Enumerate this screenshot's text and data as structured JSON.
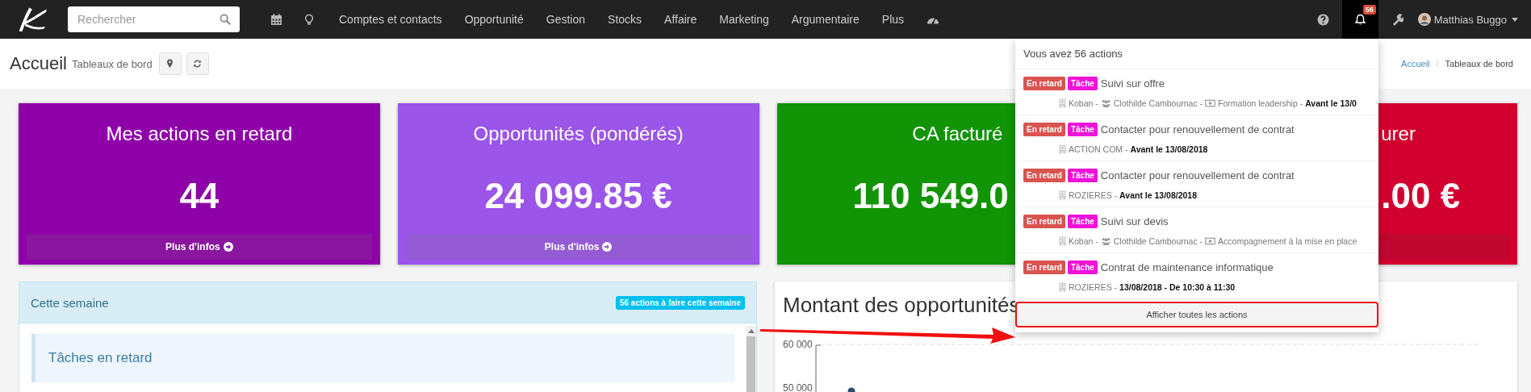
{
  "navbar": {
    "search": {
      "placeholder": "Rechercher"
    },
    "menu": [
      "Comptes et contacts",
      "Opportunité",
      "Gestion",
      "Stocks",
      "Affaire",
      "Marketing",
      "Argumentaire",
      "Plus"
    ],
    "notifications": {
      "count": "56",
      "selected": true
    },
    "user": {
      "name": "Matthias Buggo"
    }
  },
  "header": {
    "title": "Accueil",
    "subtitle": "Tableaux de bord",
    "breadcrumb": {
      "separator": "/",
      "items": [
        {
          "label": "Accueil",
          "link": true
        },
        {
          "label": "Tableaux de bord",
          "link": false
        }
      ]
    }
  },
  "cards": [
    {
      "kind": "full",
      "color": "#8e00a8",
      "title": "Mes actions en retard",
      "value": "44",
      "footer": "Plus d'infos"
    },
    {
      "kind": "full",
      "color": "#9b55e8",
      "title": "Opportunités (pondérés)",
      "value": "24 099.85 €",
      "footer": "Plus d'infos"
    },
    {
      "kind": "left-of-menu",
      "color": "#119405",
      "title": "CA facturé",
      "value": "110 549.0"
    },
    {
      "kind": "right-of-menu",
      "color": "#d2002f",
      "title": "urer",
      "value": ".00 €"
    }
  ],
  "week_panel": {
    "title": "Cette semaine",
    "badge": "56 actions à faire cette semaine",
    "section": "Tâches en retard"
  },
  "chart_panel": {
    "title": "Montant des opportunités",
    "y_axis_labels": [
      "60 000",
      "50 000"
    ]
  },
  "actions_menu": {
    "header": "Vous avez 56 actions",
    "items": [
      {
        "status": "En retard",
        "type": "Tâche",
        "title": "Suivi sur offre",
        "meta": [
          {
            "kind": "company",
            "text": "Koban -"
          },
          {
            "kind": "contact",
            "text": "Clothilde Cambournac -"
          },
          {
            "kind": "project",
            "text": "Formation leadership -"
          },
          {
            "kind": "date",
            "text": "Avant le 13/0"
          }
        ]
      },
      {
        "status": "En retard",
        "type": "Tâche",
        "title": "Contacter pour renouvellement de contrat",
        "meta": [
          {
            "kind": "company",
            "text": "ACTION COM -"
          },
          {
            "kind": "date",
            "text": "Avant le 13/08/2018"
          }
        ]
      },
      {
        "status": "En retard",
        "type": "Tâche",
        "title": "Contacter pour renouvellement de contrat",
        "meta": [
          {
            "kind": "company",
            "text": "ROZIERES -"
          },
          {
            "kind": "date",
            "text": "Avant le 13/08/2018"
          }
        ]
      },
      {
        "status": "En retard",
        "type": "Tâche",
        "title": "Suivi sur devis",
        "meta": [
          {
            "kind": "company",
            "text": "Koban -"
          },
          {
            "kind": "contact",
            "text": "Clothilde Cambournac -"
          },
          {
            "kind": "project",
            "text": "Accompagnement à la mise en place"
          }
        ]
      },
      {
        "status": "En retard",
        "type": "Tâche",
        "title": "Contrat de maintenance informatique",
        "meta": [
          {
            "kind": "company",
            "text": "ROZIERES -"
          },
          {
            "kind": "date",
            "text": "13/08/2018 - De 10:30 à 11:30"
          }
        ]
      }
    ],
    "footer": {
      "label": "Afficher toutes les actions",
      "highlighted": true
    }
  }
}
